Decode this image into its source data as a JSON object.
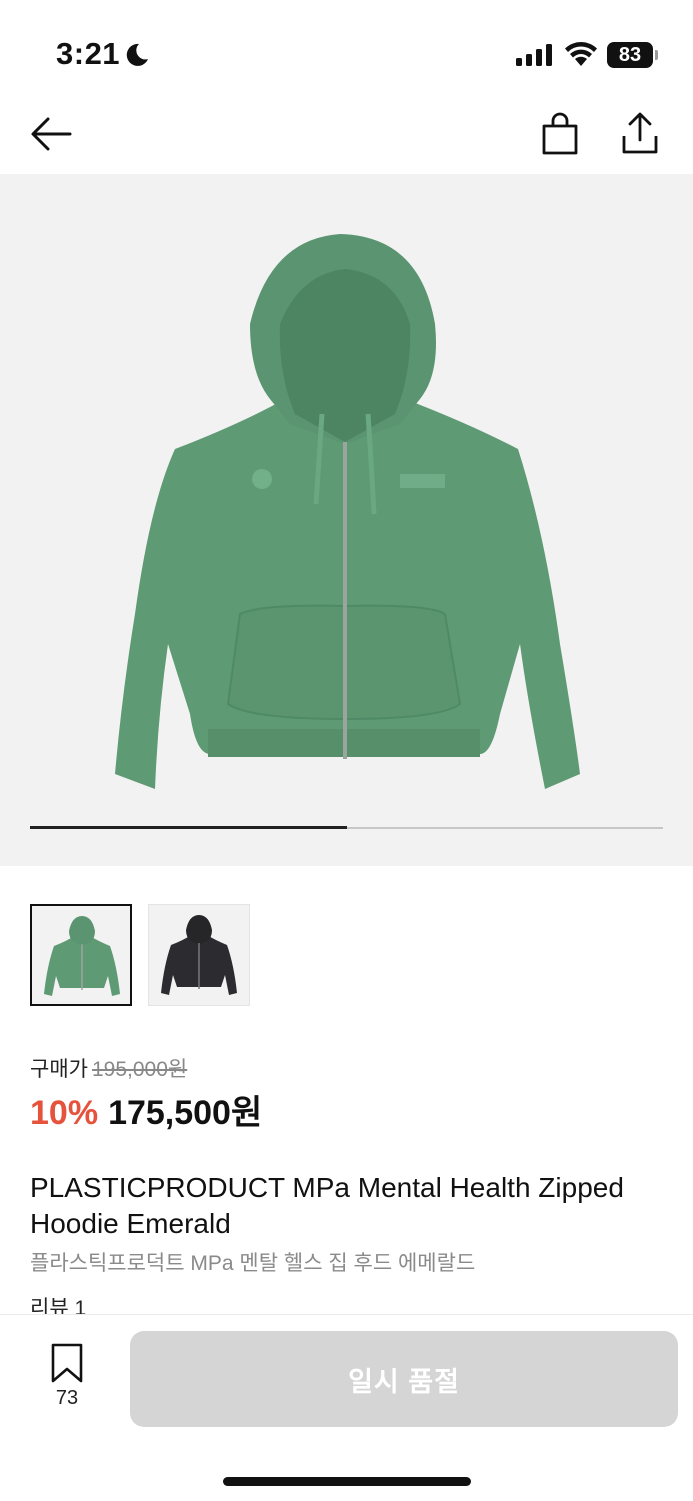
{
  "status_bar": {
    "time": "3:21",
    "battery": "83",
    "icons": [
      "moon-icon",
      "cellular-signal-icon",
      "wifi-icon",
      "battery-icon"
    ]
  },
  "nav": {
    "icons": [
      "back-arrow-icon",
      "shopping-bag-icon",
      "share-icon"
    ]
  },
  "gallery": {
    "image_subject": "green zip hoodie",
    "progress_fraction": 0.5,
    "thumbnails": [
      "green zip hoodie",
      "black zip hoodie"
    ],
    "active_thumbnail": 0
  },
  "price": {
    "label": "구매가",
    "original": "195,000원",
    "discount": "10%",
    "sale": "175,500원",
    "discount_color": "#e5533d"
  },
  "product": {
    "name_en": "PLASTICPRODUCT MPa Mental Health Zipped Hoodie Emerald",
    "name_ko": "플라스틱프로덕트 MPa 멘탈 헬스 집 후드 에메랄드",
    "review": "리뷰 1"
  },
  "bottom_bar": {
    "bookmark_count": "73",
    "button_label": "일시 품절",
    "button_color": "#d5d5d5"
  }
}
